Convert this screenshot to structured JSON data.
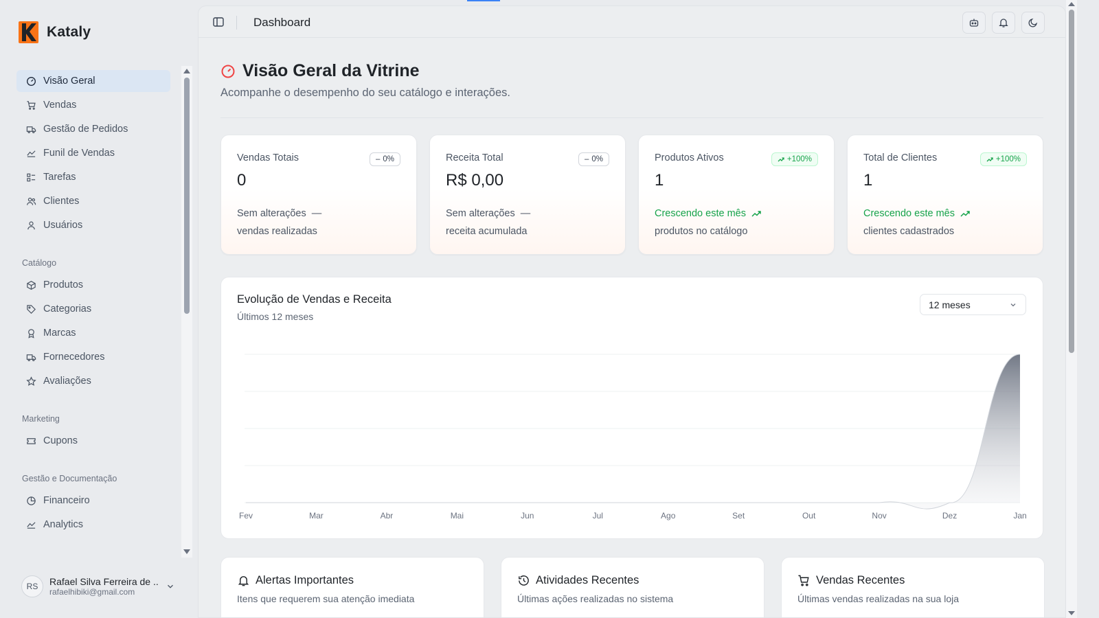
{
  "brand": {
    "name": "Kataly"
  },
  "sidebar": {
    "items": [
      {
        "label": "Visão Geral",
        "icon": "gauge-icon",
        "active": true
      },
      {
        "label": "Vendas",
        "icon": "cart-icon"
      },
      {
        "label": "Gestão de Pedidos",
        "icon": "truck-icon"
      },
      {
        "label": "Funil de Vendas",
        "icon": "area-chart-icon"
      },
      {
        "label": "Tarefas",
        "icon": "tasks-icon"
      },
      {
        "label": "Clientes",
        "icon": "users-icon"
      },
      {
        "label": "Usuários",
        "icon": "user-icon"
      }
    ],
    "groups": [
      {
        "label": "Catálogo",
        "items": [
          {
            "label": "Produtos",
            "icon": "package-icon"
          },
          {
            "label": "Categorias",
            "icon": "tag-icon"
          },
          {
            "label": "Marcas",
            "icon": "award-icon"
          },
          {
            "label": "Fornecedores",
            "icon": "truck-icon"
          },
          {
            "label": "Avaliações",
            "icon": "star-icon"
          }
        ]
      },
      {
        "label": "Marketing",
        "items": [
          {
            "label": "Cupons",
            "icon": "ticket-icon"
          }
        ]
      },
      {
        "label": "Gestão e Documentação",
        "items": [
          {
            "label": "Financeiro",
            "icon": "pie-chart-icon"
          },
          {
            "label": "Analytics",
            "icon": "area-chart-icon"
          }
        ]
      }
    ]
  },
  "user": {
    "initials": "RS",
    "name": "Rafael Silva Ferreira de ...",
    "email": "rafaelhibiki@gmail.com"
  },
  "topbar": {
    "breadcrumb": "Dashboard"
  },
  "page": {
    "title": "Visão Geral da Vitrine",
    "subtitle": "Acompanhe o desempenho do seu catálogo e interações."
  },
  "stats": [
    {
      "label": "Vendas Totais",
      "badge": "0%",
      "badge_type": "neutral",
      "value": "0",
      "trend": "Sem alterações",
      "trend_type": "neutral",
      "desc": "vendas realizadas"
    },
    {
      "label": "Receita Total",
      "badge": "0%",
      "badge_type": "neutral",
      "value": "R$ 0,00",
      "trend": "Sem alterações",
      "trend_type": "neutral",
      "desc": "receita acumulada"
    },
    {
      "label": "Produtos Ativos",
      "badge": "+100%",
      "badge_type": "up",
      "value": "1",
      "trend": "Crescendo este mês",
      "trend_type": "up",
      "desc": "produtos no catálogo"
    },
    {
      "label": "Total de Clientes",
      "badge": "+100%",
      "badge_type": "up",
      "value": "1",
      "trend": "Crescendo este mês",
      "trend_type": "up",
      "desc": "clientes cadastrados"
    }
  ],
  "chart": {
    "title": "Evolução de Vendas e Receita",
    "subtitle": "Últimos 12 meses",
    "range": "12 meses"
  },
  "chart_data": {
    "type": "area",
    "categories": [
      "Fev",
      "Mar",
      "Abr",
      "Mai",
      "Jun",
      "Jul",
      "Ago",
      "Set",
      "Out",
      "Nov",
      "Dez",
      "Jan"
    ],
    "values": [
      0,
      0,
      0,
      0,
      0,
      0,
      0,
      0,
      0,
      0,
      0,
      1
    ],
    "title": "Evolução de Vendas e Receita",
    "subtitle": "Últimos 12 meses",
    "xlabel": "",
    "ylabel": "",
    "grid": true,
    "color": "#9ca3af"
  },
  "bottom_cards": [
    {
      "title": "Alertas Importantes",
      "subtitle": "Itens que requerem sua atenção imediata",
      "icon": "bell-icon"
    },
    {
      "title": "Atividades Recentes",
      "subtitle": "Últimas ações realizadas no sistema",
      "icon": "history-icon"
    },
    {
      "title": "Vendas Recentes",
      "subtitle": "Últimas vendas realizadas na sua loja",
      "icon": "cart-icon"
    }
  ],
  "colors": {
    "accent": "#f97316",
    "up": "#16a34a",
    "active_bg": "#dbe6f3"
  }
}
